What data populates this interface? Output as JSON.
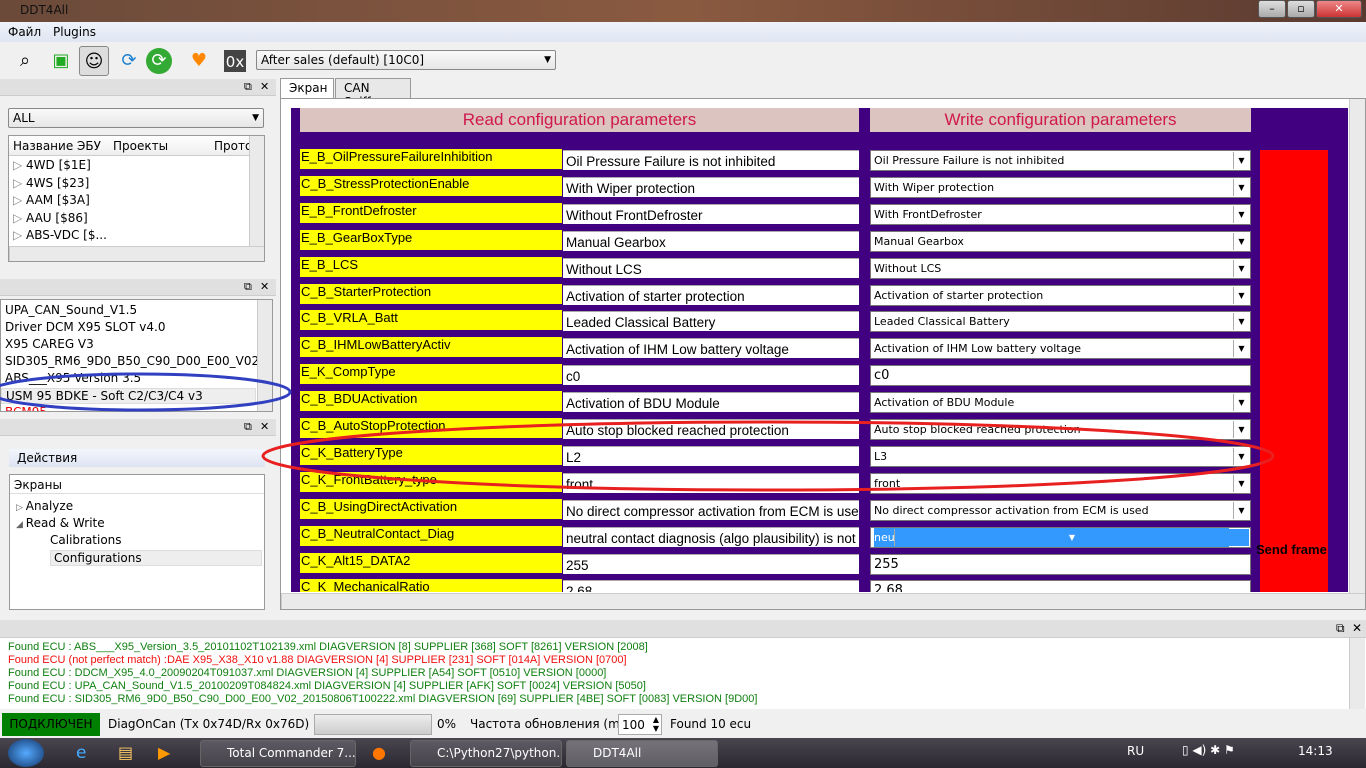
{
  "window": {
    "title": "DDT4All"
  },
  "menu": [
    "Файл",
    "Plugins"
  ],
  "toolbar": {
    "session_combo": "After sales (default) [10C0]",
    "hex_label": "0x",
    "icons": [
      "scan-icon",
      "monitor-icon",
      "sniffer-icon",
      "refresh-icon",
      "reload-icon",
      "heart-icon",
      "hex-icon"
    ]
  },
  "ecu_panel": {
    "filter": "ALL",
    "columns": [
      "Название ЭБУ",
      "Проекты",
      "Прото"
    ],
    "items": [
      "4WD [$1E]",
      "4WS [$23]",
      "AAM [$3A]",
      "AAU [$86]",
      "ABS-VDC [$..."
    ]
  },
  "found_list": {
    "items": [
      "UPA_CAN_Sound_V1.5",
      "Driver DCM X95 SLOT v4.0",
      "X95 CAREG V3",
      "SID305_RM6_9D0_B50_C90_D00_E00_V02",
      "ABS___X95 Version 3.5",
      "USM 95 BDKE - Soft C2/C3/C4 v3",
      "BCM95 ..."
    ],
    "selected": 5
  },
  "actions": {
    "title": "Действия",
    "tree_header": "Экраны",
    "items": [
      {
        "label": "Analyze",
        "level": 0,
        "expanded": false
      },
      {
        "label": "Read & Write",
        "level": 0,
        "expanded": true
      },
      {
        "label": "Calibrations",
        "level": 1
      },
      {
        "label": "Configurations",
        "level": 1,
        "selected": true
      }
    ]
  },
  "tabs": [
    {
      "label": "Экран",
      "active": true
    },
    {
      "label": "CAN Sniffer"
    }
  ],
  "screen": {
    "read_header": "Read configuration parameters",
    "write_header": "Write configuration parameters",
    "send_label": "Send frame",
    "rows": [
      {
        "name": "E_B_OilPressureFailureInhibition",
        "read": "Oil Pressure Failure is not inhibited",
        "write": "Oil Pressure Failure is not inhibited",
        "type": "combo"
      },
      {
        "name": "C_B_StressProtectionEnable",
        "read": "With Wiper protection",
        "write": "With Wiper protection",
        "type": "combo"
      },
      {
        "name": "E_B_FrontDefroster",
        "read": "Without FrontDefroster",
        "write": "With FrontDefroster",
        "type": "combo"
      },
      {
        "name": "E_B_GearBoxType",
        "read": "Manual Gearbox",
        "write": "Manual Gearbox",
        "type": "combo"
      },
      {
        "name": "E_B_LCS",
        "read": "Without LCS",
        "write": "Without LCS",
        "type": "combo"
      },
      {
        "name": "C_B_StarterProtection",
        "read": "Activation of starter protection",
        "write": "Activation of starter protection",
        "type": "combo"
      },
      {
        "name": "C_B_VRLA_Batt",
        "read": "Leaded Classical Battery",
        "write": "Leaded Classical Battery",
        "type": "combo"
      },
      {
        "name": "C_B_IHMLowBatteryActiv",
        "read": "Activation of IHM Low battery voltage",
        "write": "Activation of IHM Low battery voltage",
        "type": "combo"
      },
      {
        "name": "E_K_CompType",
        "read": "c0",
        "write": "c0",
        "type": "text"
      },
      {
        "name": "C_B_BDUActivation",
        "read": "Activation of BDU Module",
        "write": "Activation of BDU Module",
        "type": "combo"
      },
      {
        "name": "C_B_AutoStopProtection",
        "read": "Auto stop blocked reached protection",
        "write": "Auto stop blocked reached protection",
        "type": "combo"
      },
      {
        "name": "C_K_BatteryType",
        "read": "L2",
        "write": "L3",
        "type": "combo"
      },
      {
        "name": "C_K_FrontBattery_type",
        "read": "front",
        "write": "front",
        "type": "combo"
      },
      {
        "name": "C_B_UsingDirectActivation",
        "read": "No direct compressor activation from ECM is used",
        "write": "No direct compressor activation from ECM is used",
        "type": "combo"
      },
      {
        "name": "C_B_NeutralContact_Diag",
        "read": "neutral contact diagnosis (algo plausibility) is not inhibited",
        "write": "neutral contact diagnosis (algo plausibility) is inhibited",
        "type": "combo",
        "selected": true
      },
      {
        "name": "C_K_Alt15_DATA2",
        "read": "255",
        "write": "255",
        "type": "text"
      },
      {
        "name": "C_K_MechanicalRatio",
        "read": "2.68",
        "write": "2.68",
        "type": "text"
      }
    ]
  },
  "log": [
    {
      "text": "Found ECU : ABS___X95_Version_3.5_20101102T102139.xml DIAGVERSION [8] SUPPLIER [368] SOFT [8261] VERSION [2008]",
      "color": "#108010"
    },
    {
      "text": "Found ECU (not perfect match) :DAE X95_X38_X10 v1.88 DIAGVERSION [4] SUPPLIER [231] SOFT [014A] VERSION [0700]",
      "color": "#f01010"
    },
    {
      "text": "Found ECU : DDCM_X95_4.0_20090204T091037.xml DIAGVERSION [4] SUPPLIER [A54] SOFT [0510] VERSION [0000]",
      "color": "#108010"
    },
    {
      "text": "Found ECU : UPA_CAN_Sound_V1.5_20100209T084824.xml DIAGVERSION [4] SUPPLIER [AFK] SOFT [0024] VERSION [5050]",
      "color": "#108010"
    },
    {
      "text": "Found ECU : SID305_RM6_9D0_B50_C90_D00_E00_V02_20150806T100222.xml DIAGVERSION [69] SUPPLIER [4BE] SOFT [0083] VERSION [9D00]",
      "color": "#108010"
    }
  ],
  "status": {
    "connection": "ПОДКЛЮЧЕН",
    "connection_color": "#008000",
    "protocol": "DiagOnCan (Tx 0x74D/Rx 0x76D)",
    "progress_percent": 0,
    "progress_label": "0%",
    "refresh_label": "Частота обновления (ms):",
    "refresh_value": "100",
    "found": "Found 10 ecu"
  },
  "taskbar": {
    "tasks": [
      "Total Commander 7....",
      "C:\\Python27\\python...",
      "DDT4All"
    ],
    "lang": "RU",
    "clock": "14:13"
  }
}
